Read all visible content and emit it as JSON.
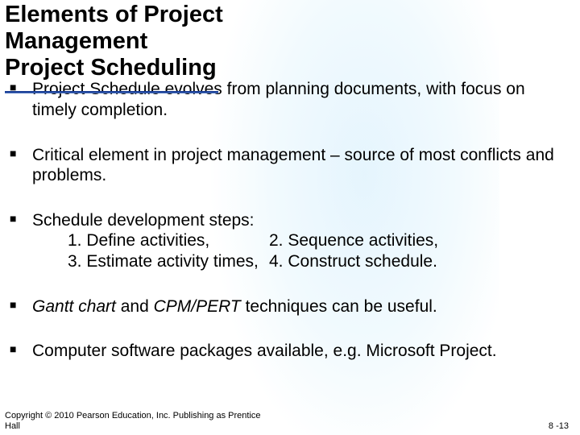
{
  "title_line1": "Elements of Project",
  "title_line2": "Management",
  "title_line3": "Project Scheduling",
  "bullet1": "Project Schedule evolves from planning documents, with focus on timely completion.",
  "bullet2": "Critical element in project management – source of most conflicts and problems.",
  "bullet3_intro": "Schedule development steps:",
  "step1": "1. Define activities,",
  "step2": "2. Sequence activities,",
  "step3": "3. Estimate activity times,",
  "step4": "4. Construct schedule.",
  "bullet4_em1": "Gantt chart",
  "bullet4_mid": " and ",
  "bullet4_em2": "CPM/PERT",
  "bullet4_end": " techniques can be useful.",
  "bullet5": "Computer software packages available, e.g. Microsoft Project.",
  "copyright_line1": "Copyright © 2010 Pearson Education, Inc. Publishing as Prentice",
  "copyright_line2": "Hall",
  "page_number": "8 -13"
}
